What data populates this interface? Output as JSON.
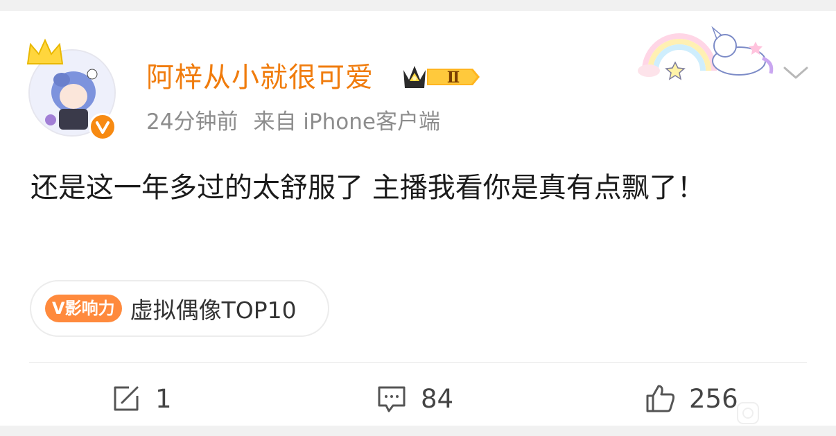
{
  "post": {
    "user_name": "阿梓从小就很可爱",
    "vip_level": "Ⅱ",
    "time": "24分钟前",
    "source": "来自 iPhone客户端",
    "content": "还是这一年多过的太舒服了 主播我看你是真有点飘了！",
    "topic_badge": "V影响力",
    "topic_text": "虚拟偶像TOP10"
  },
  "actions": {
    "repost_count": "1",
    "comment_count": "84",
    "like_count": "256"
  },
  "colors": {
    "name": "#f07c0d",
    "verified": "#f78a12",
    "topic_badge": "#ff8a3d"
  },
  "icons": {
    "repost": "edit-share-icon",
    "comment": "comment-icon",
    "like": "thumbs-up-icon",
    "more": "chevron-down-icon"
  }
}
